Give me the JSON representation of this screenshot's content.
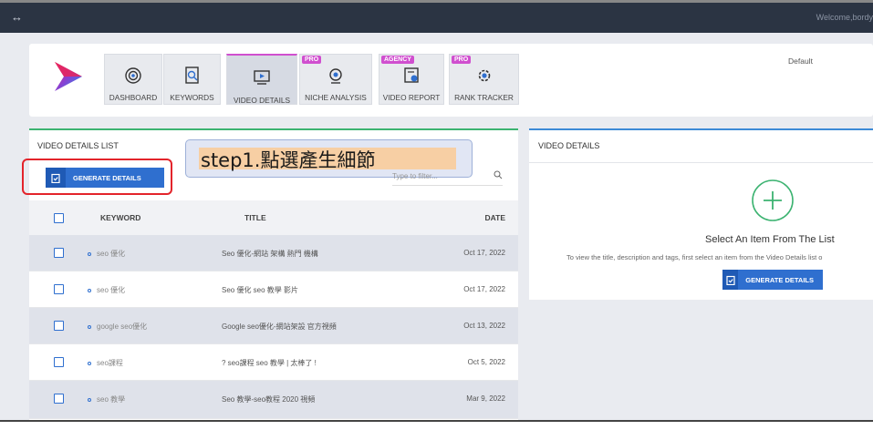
{
  "topbar": {
    "welcome": "Welcome,bordy"
  },
  "tabs": [
    {
      "label": "DASHBOARD",
      "badge": "",
      "icon": "target-icon"
    },
    {
      "label": "KEYWORDS",
      "badge": "",
      "icon": "search-doc-icon"
    },
    {
      "label": "VIDEO DETAILS",
      "badge": "",
      "icon": "video-details-icon"
    },
    {
      "label": "NICHE ANALYSIS",
      "badge": "PRO",
      "icon": "niche-icon"
    },
    {
      "label": "VIDEO REPORT",
      "badge": "AGENCY",
      "icon": "report-icon"
    },
    {
      "label": "RANK TRACKER",
      "badge": "PRO",
      "icon": "gear-icon"
    }
  ],
  "select_default": "Default",
  "list": {
    "title": "VIDEO DETAILS LIST",
    "generate_label": "GENERATE DETAILS",
    "search_placeholder": "Type to filter...",
    "callout": "step1.點選產生細節",
    "headers": {
      "keyword": "KEYWORD",
      "title": "TITLE",
      "date": "DATE"
    },
    "rows": [
      {
        "keyword": "seo 優化",
        "title": "Seo 優化-網站 架構 熱門 機構",
        "date": "Oct 17, 2022"
      },
      {
        "keyword": "seo 優化",
        "title": "Seo 優化 seo 教學 影片",
        "date": "Oct 17, 2022"
      },
      {
        "keyword": "google seo優化",
        "title": "Google seo優化-網站架設 官方視頻",
        "date": "Oct 13, 2022"
      },
      {
        "keyword": "seo課程",
        "title": "? seo課程 seo 教學 | 太棒了 !",
        "date": "Oct 5, 2022"
      },
      {
        "keyword": "seo 教學",
        "title": "Seo 教學-seo教程 2020 視頻",
        "date": "Mar 9, 2022"
      }
    ]
  },
  "details": {
    "title": "VIDEO DETAILS",
    "empty_title": "Select An Item From The List",
    "empty_sub": "To view the title, description and tags, first select an item from the Video Details list o",
    "generate_label": "GENERATE DETAILS"
  },
  "colors": {
    "accent": "#2f6fcf",
    "badge": "#d04fcf",
    "green": "#3cb371",
    "topbar": "#2b3443"
  }
}
